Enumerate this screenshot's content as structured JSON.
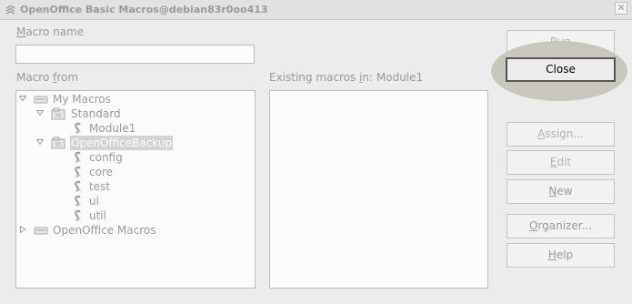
{
  "window": {
    "title": "OpenOffice Basic Macros@debian83r0oo413",
    "close_glyph": "✕"
  },
  "macro_name": {
    "label_u": "M",
    "label_rest": "acro name",
    "value": ""
  },
  "macro_from": {
    "label_pre": "Macro ",
    "label_u": "f",
    "label_rest": "rom"
  },
  "existing": {
    "label_pre": "Existing macros ",
    "label_u": "i",
    "label_rest": "n: Module1"
  },
  "tree": [
    {
      "label": "My Macros",
      "icon": "library-container-icon",
      "expanded": true,
      "level": 0
    },
    {
      "label": "Standard",
      "icon": "library-icon",
      "expanded": true,
      "level": 1
    },
    {
      "label": "Module1",
      "icon": "basic-module-icon",
      "level": 2
    },
    {
      "label": "OpenOfficeBackup",
      "icon": "library-icon",
      "expanded": true,
      "level": 1,
      "selected": true
    },
    {
      "label": "config",
      "icon": "basic-module-icon",
      "level": 2
    },
    {
      "label": "core",
      "icon": "basic-module-icon",
      "level": 2
    },
    {
      "label": "test",
      "icon": "basic-module-icon",
      "level": 2
    },
    {
      "label": "ui",
      "icon": "basic-module-icon",
      "level": 2
    },
    {
      "label": "util",
      "icon": "basic-module-icon",
      "level": 2
    },
    {
      "label": "OpenOffice Macros",
      "icon": "library-container-icon",
      "expanded": false,
      "level": 0
    }
  ],
  "buttons": {
    "run": {
      "u": "R",
      "rest": "un"
    },
    "close": {
      "label": "Close"
    },
    "assign": {
      "u": "A",
      "rest": "ssign..."
    },
    "edit": {
      "u": "E",
      "rest": "dit"
    },
    "new": {
      "u": "N",
      "rest": "ew"
    },
    "organizer": {
      "u": "O",
      "rest": "rganizer..."
    },
    "help": {
      "u": "H",
      "rest": "elp"
    }
  },
  "colors": {
    "highlight": "#c9c6bc",
    "selection": "#d3d3d3",
    "disabled_text": "#b2b2b2"
  }
}
